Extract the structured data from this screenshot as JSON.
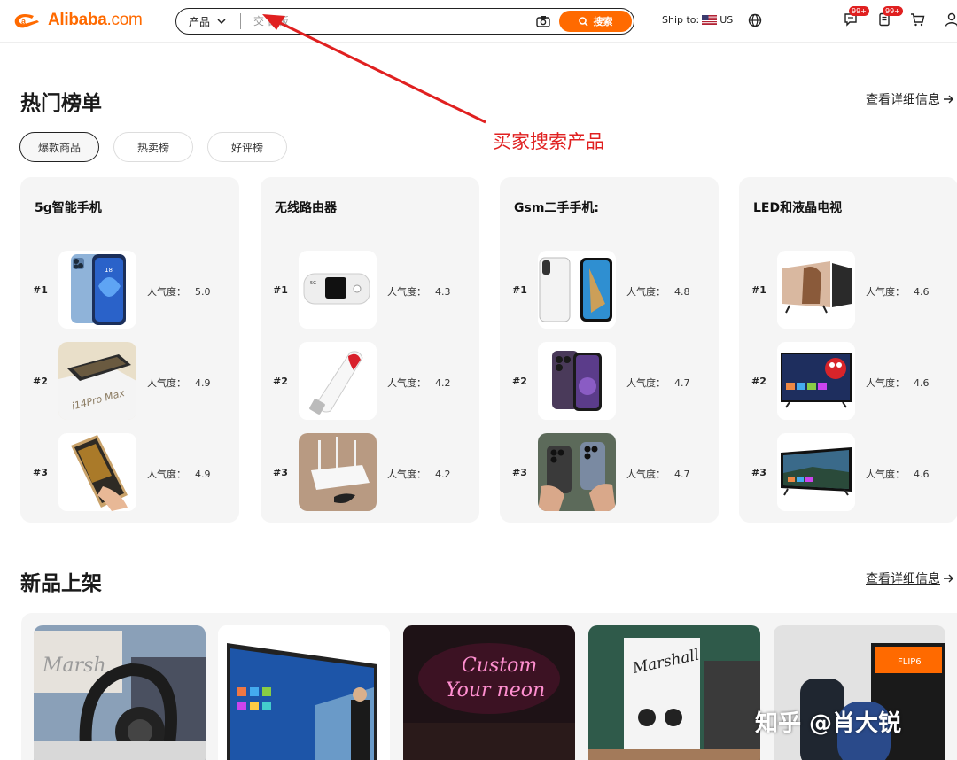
{
  "header": {
    "logo_text": "Alibaba",
    "logo_suffix": ".com",
    "search": {
      "category": "产品",
      "placeholder": "交 白板",
      "button_label": "搜索"
    },
    "ship_to_label": "Ship to:",
    "ship_to_country": "US",
    "messages_badge": "99+",
    "orders_badge": "99+"
  },
  "hot_ranking": {
    "title": "热门榜单",
    "view_more": "查看详细信息",
    "tabs": [
      {
        "label": "爆款商品",
        "active": true
      },
      {
        "label": "热卖榜",
        "active": false
      },
      {
        "label": "好评榜",
        "active": false
      }
    ],
    "popularity_label": "人气度：",
    "cards": [
      {
        "title": "5g智能手机",
        "items": [
          {
            "rank": "#1",
            "score": "5.0",
            "image": "blue-iphone"
          },
          {
            "rank": "#2",
            "score": "4.9",
            "image": "i14pro-max-box"
          },
          {
            "rank": "#3",
            "score": "4.9",
            "image": "gold-iphone-in-hand"
          }
        ]
      },
      {
        "title": "无线路由器",
        "items": [
          {
            "rank": "#1",
            "score": "4.3",
            "image": "pocket-mifi"
          },
          {
            "rank": "#2",
            "score": "4.2",
            "image": "usb-4g-dongle"
          },
          {
            "rank": "#3",
            "score": "4.2",
            "image": "white-router"
          }
        ]
      },
      {
        "title": "Gsm二手手机:",
        "items": [
          {
            "rank": "#1",
            "score": "4.8",
            "image": "iphone-x-front-back"
          },
          {
            "rank": "#2",
            "score": "4.7",
            "image": "purple-iphone-pro"
          },
          {
            "rank": "#3",
            "score": "4.7",
            "image": "two-iphones-in-hands"
          }
        ]
      },
      {
        "title": "LED和液晶电视",
        "items": [
          {
            "rank": "#1",
            "score": "4.6",
            "image": "tv-portrait"
          },
          {
            "rank": "#2",
            "score": "4.6",
            "image": "tv-elmo"
          },
          {
            "rank": "#3",
            "score": "4.6",
            "image": "tv-landscape"
          }
        ]
      }
    ]
  },
  "new_arrivals": {
    "title": "新品上架",
    "view_more": "查看详细信息",
    "items": [
      {
        "image": "marshall-headphones",
        "logo_text": "Marsh"
      },
      {
        "image": "interactive-whiteboard"
      },
      {
        "image": "custom-neon-sign",
        "neon_line1": "Custom",
        "neon_line2": "Your neon"
      },
      {
        "image": "marshall-earbuds",
        "logo_text": "Marshall"
      },
      {
        "image": "jbl-speaker",
        "logo_text": "FLIP6"
      }
    ]
  },
  "annotation": {
    "text": "买家搜索产品"
  },
  "watermark": {
    "text": "知乎 @肖大锐"
  },
  "colors": {
    "brand": "#ff6a00",
    "annotation_red": "#e02020",
    "card_bg": "#f5f5f5"
  }
}
